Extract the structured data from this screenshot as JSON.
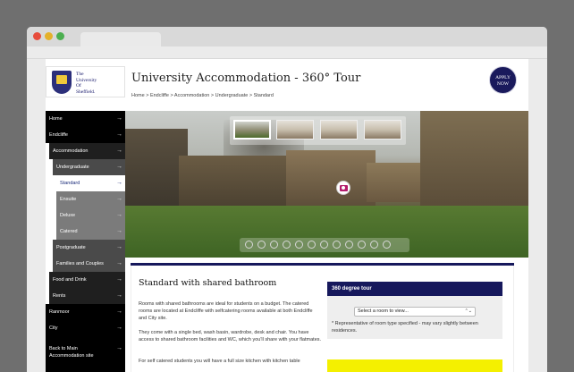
{
  "browser": {
    "window_controls": [
      "close",
      "minimize",
      "maximize"
    ]
  },
  "header": {
    "logo_text": [
      "The",
      "University",
      "Of",
      "Sheffield."
    ],
    "title": "University Accommodation - 360° Tour",
    "breadcrumb": "Home > Endcliffe > Accommodation > Undergraduate > Standard",
    "apply": [
      "APPLY",
      "NOW"
    ]
  },
  "sidebar": {
    "items": [
      {
        "label": "Home"
      },
      {
        "label": "Endcliffe"
      },
      {
        "label": "Accommodation"
      },
      {
        "label": "Undergraduate"
      },
      {
        "label": "Standard"
      },
      {
        "label": "Ensuite"
      },
      {
        "label": "Deluxe"
      },
      {
        "label": "Catered"
      },
      {
        "label": "Postgraduate"
      },
      {
        "label": "Families and Couples"
      },
      {
        "label": "Food and Drink"
      },
      {
        "label": "Rents"
      },
      {
        "label": "Ranmoor"
      },
      {
        "label": "City"
      },
      {
        "label": "Back to Main"
      },
      {
        "label": "Accommodation site"
      }
    ],
    "arrow": "→"
  },
  "content": {
    "title": "Standard with shared bathroom",
    "p1": "Rooms with shared bathrooms are ideal for students on a budget. The catered rooms are located at Endcliffe with selfcatering rooms available at both Endcliffe and City site.",
    "p2": "They come with a single bed, wash basin, wardrobe, desk and chair. You have access to shared bathroom facilities and WC, which you'll share with your flatmates.",
    "p3": "For self catered students you will have a full size kitchen with kitchen table"
  },
  "tour_panel": {
    "title": "360 degree tour",
    "select_value": "Select a room to view...",
    "note": "* Representative of room type specified - may vary slightly between residences."
  },
  "icons": {
    "select_chevron": "⌃⌄"
  }
}
